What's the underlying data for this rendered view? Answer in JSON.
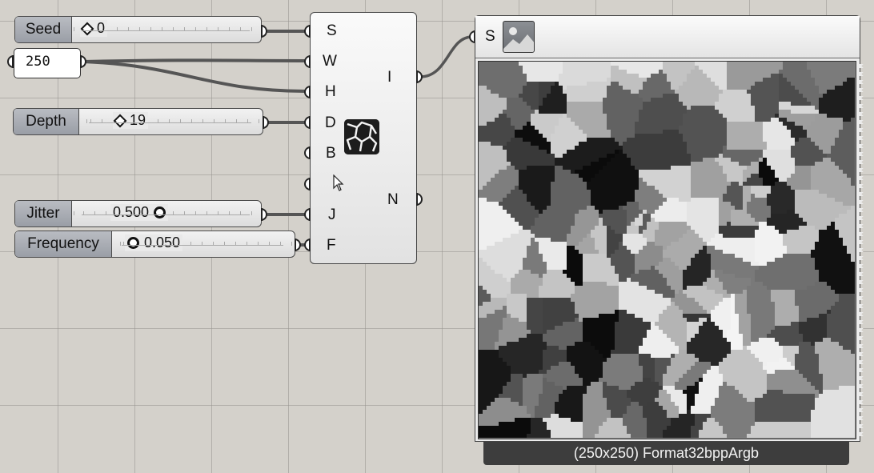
{
  "sliders": {
    "seed": {
      "name": "Seed",
      "value": "0"
    },
    "depth": {
      "name": "Depth",
      "value": "19"
    },
    "jitter": {
      "name": "Jitter",
      "value": "0.500"
    },
    "frequency": {
      "name": "Frequency",
      "value": "0.050"
    }
  },
  "number_panel": {
    "value": "250"
  },
  "component": {
    "icon": "voronoi-cells-icon",
    "inputs": [
      "S",
      "W",
      "H",
      "D",
      "B",
      "",
      "J",
      "F"
    ],
    "outputs": [
      "I",
      "N"
    ]
  },
  "viewer": {
    "input_label": "S",
    "icon": "image-icon",
    "caption": "(250x250) Format32bppArgb"
  },
  "colors": {
    "canvas": "#d4d1cb",
    "wire": "#555555",
    "slider_name": "#a8abb2",
    "caption_bar": "#3d3d3d"
  }
}
